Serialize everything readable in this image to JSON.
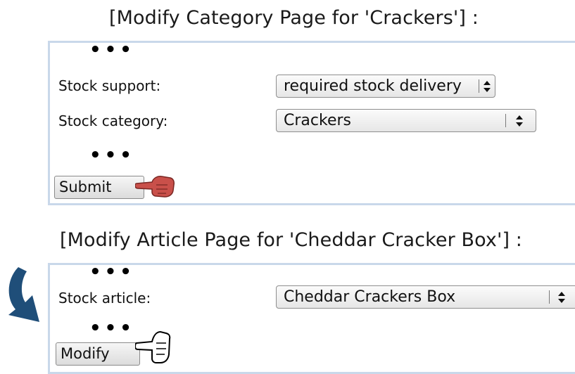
{
  "top": {
    "caption": "[Modify Category Page for 'Crackers'] :",
    "ellipsis_top": "•••",
    "stock_support_label": "Stock support:",
    "stock_support_value": "required stock delivery",
    "stock_category_label": "Stock category:",
    "stock_category_value": "Crackers",
    "ellipsis_mid": "•••",
    "submit_label": "Submit"
  },
  "bottom": {
    "caption": "[Modify Article Page for 'Cheddar Cracker Box'] :",
    "ellipsis_top": "•••",
    "stock_article_label": "Stock article:",
    "stock_article_value": "Cheddar Crackers Box",
    "ellipsis_mid": "•••",
    "modify_label": "Modify"
  },
  "icons": {
    "pointer_filled": "pointing-hand-icon",
    "pointer_outline": "pointing-hand-outline-icon",
    "flow_arrow": "curved-arrow-icon"
  },
  "colors": {
    "panel_border": "#c9d8ea",
    "flow_arrow": "#1f4e79",
    "hand_fill": "#c9504a"
  }
}
